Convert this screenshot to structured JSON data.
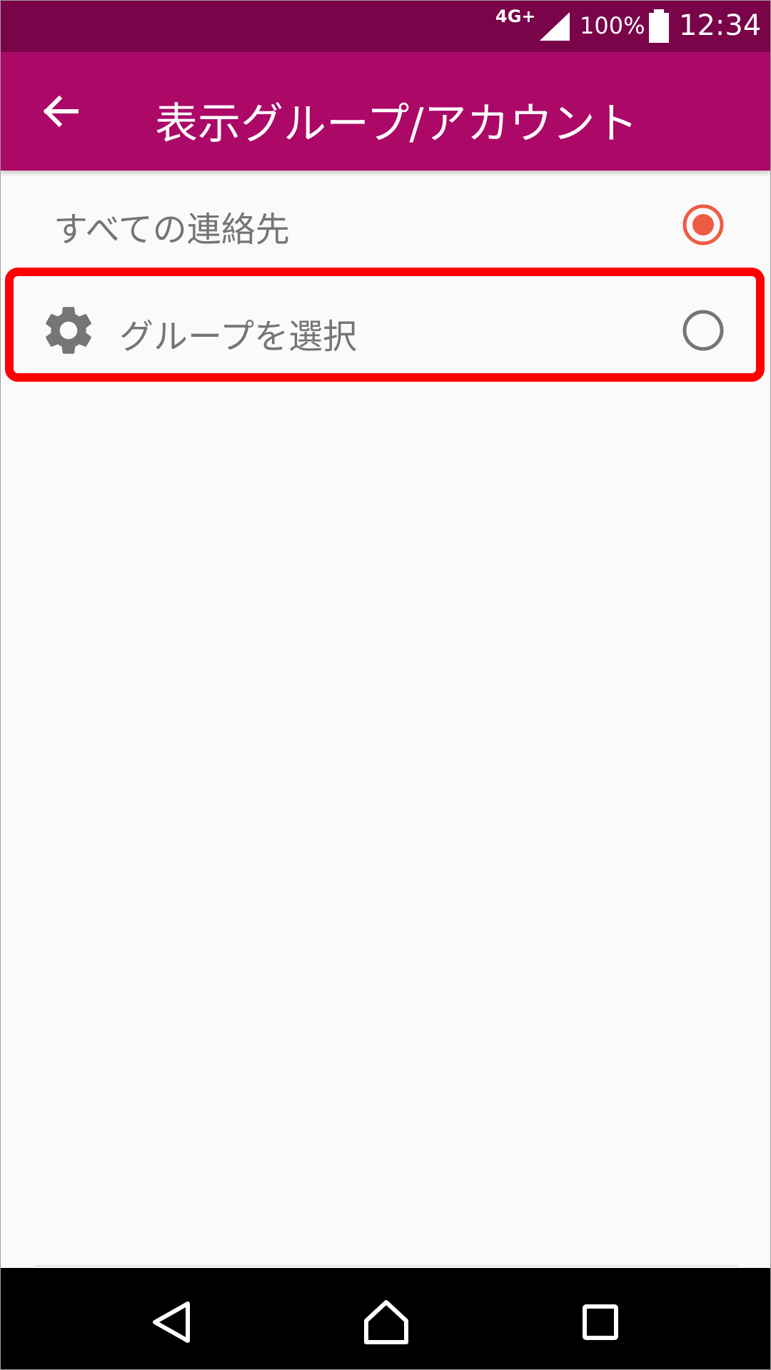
{
  "status_bar": {
    "network": "4G+",
    "battery": "100%",
    "time": "12:34",
    "icons": [
      "signal-icon",
      "battery-icon"
    ]
  },
  "app_bar": {
    "back_icon": "back-arrow-icon",
    "title": "表示グループ/アカウント"
  },
  "options": [
    {
      "label": "すべての連絡先",
      "selected": true
    },
    {
      "label": "グループを選択",
      "selected": false,
      "icon": "gear-icon"
    }
  ],
  "nav_bar": {
    "icons": [
      "nav-back-icon",
      "nav-home-icon",
      "nav-recents-icon"
    ]
  },
  "colors": {
    "status_bar": "#7a0449",
    "app_bar": "#ab0867",
    "radio_selected": "#ee5c43",
    "radio_unselected": "#757575",
    "highlight": "#ff0000"
  }
}
